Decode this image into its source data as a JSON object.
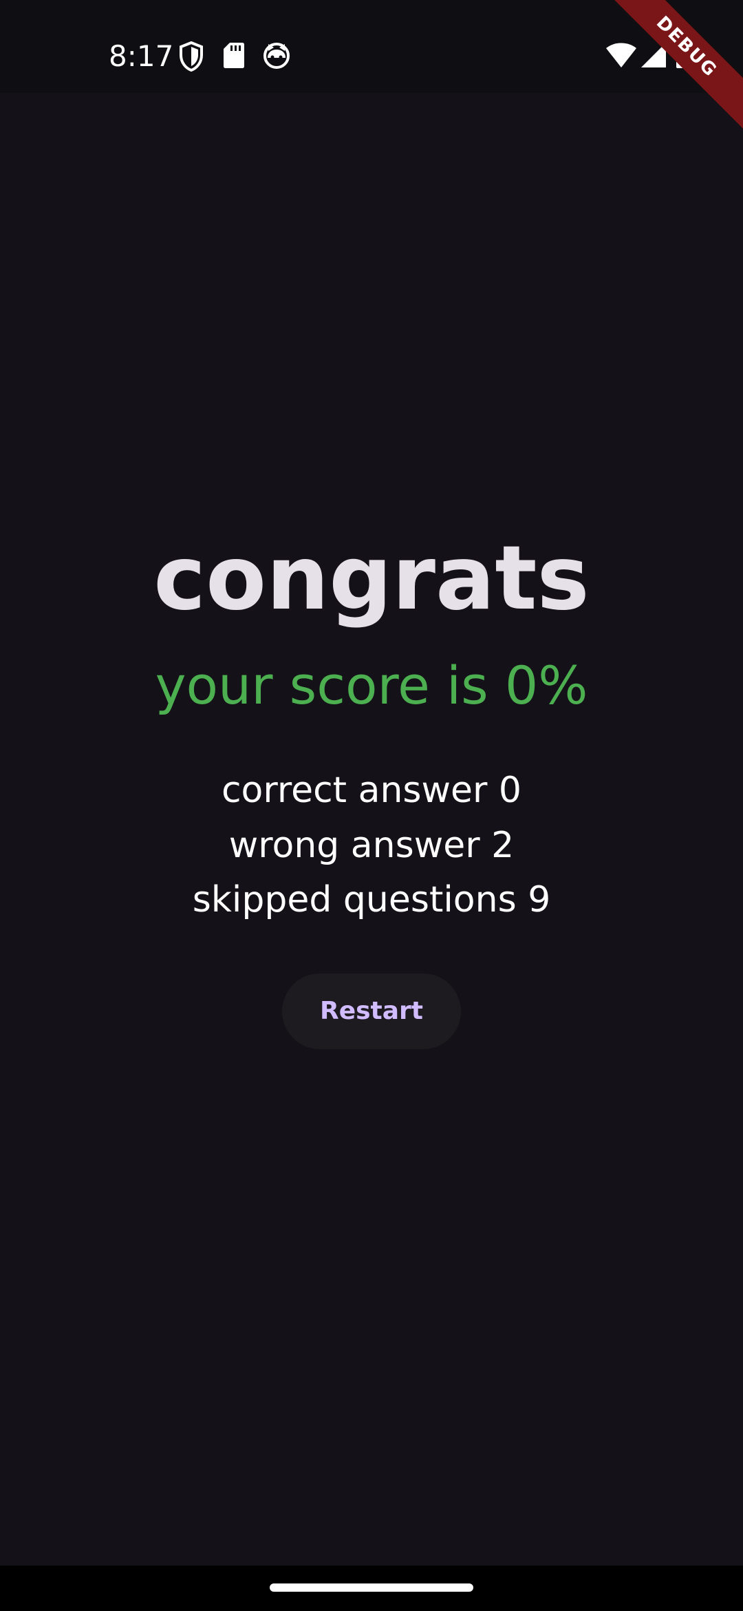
{
  "status_bar": {
    "time": "8:17",
    "left_icons": [
      "shield-icon",
      "sd-card-icon",
      "cat-face-icon"
    ],
    "right_icons": [
      "wifi-icon",
      "signal-icon",
      "battery-icon"
    ]
  },
  "debug_banner": {
    "label": "DEBUG"
  },
  "result": {
    "title": "congrats",
    "score_text": "your score is 0%",
    "score_color": "#4caf50",
    "stats": [
      "correct answer 0",
      "wrong answer 2",
      "skipped questions 9"
    ],
    "restart_label": "Restart",
    "restart_color": "#d0bcff"
  }
}
